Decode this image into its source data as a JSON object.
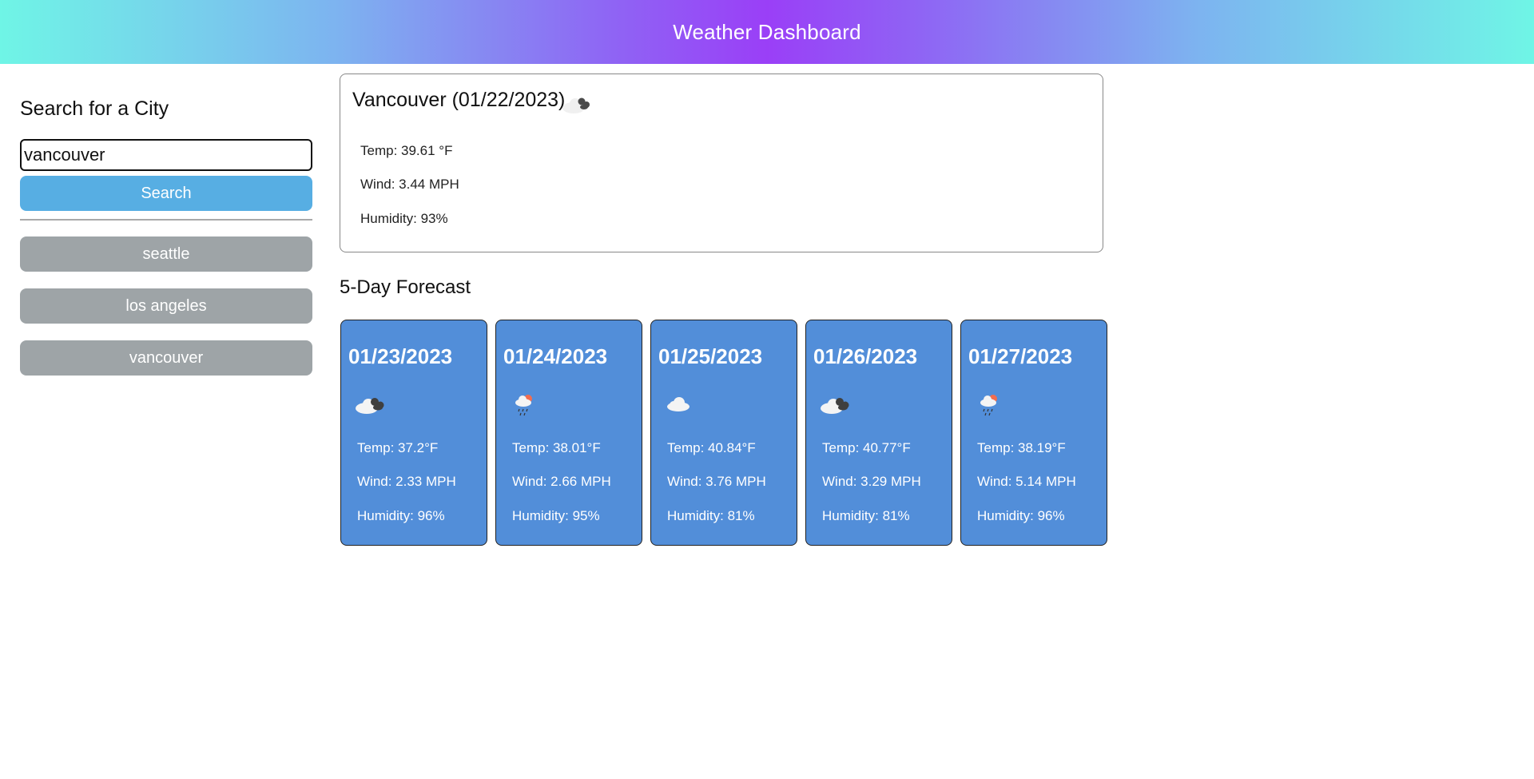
{
  "header": {
    "title": "Weather Dashboard"
  },
  "sidebar": {
    "heading": "Search for a City",
    "search_value": "vancouver",
    "search_button": "Search",
    "history": [
      "seattle",
      "los angeles",
      "vancouver"
    ]
  },
  "current": {
    "title": "Vancouver (01/22/2023)",
    "icon": "broken-clouds-icon",
    "temp": "Temp: 39.61 °F",
    "wind": "Wind: 3.44 MPH",
    "humidity": "Humidity: 93%"
  },
  "forecast": {
    "heading": "5-Day Forecast",
    "days": [
      {
        "date": "01/23/2023",
        "icon": "broken-clouds-icon",
        "temp": "Temp: 37.2°F",
        "wind": "Wind: 2.33 MPH",
        "humidity": "Humidity: 96%"
      },
      {
        "date": "01/24/2023",
        "icon": "rain-icon",
        "temp": "Temp: 38.01°F",
        "wind": "Wind: 2.66 MPH",
        "humidity": "Humidity: 95%"
      },
      {
        "date": "01/25/2023",
        "icon": "cloud-icon",
        "temp": "Temp: 40.84°F",
        "wind": "Wind: 3.76 MPH",
        "humidity": "Humidity: 81%"
      },
      {
        "date": "01/26/2023",
        "icon": "broken-clouds-icon",
        "temp": "Temp: 40.77°F",
        "wind": "Wind: 3.29 MPH",
        "humidity": "Humidity: 81%"
      },
      {
        "date": "01/27/2023",
        "icon": "rain-icon",
        "temp": "Temp: 38.19°F",
        "wind": "Wind: 5.14 MPH",
        "humidity": "Humidity: 96%"
      }
    ]
  }
}
